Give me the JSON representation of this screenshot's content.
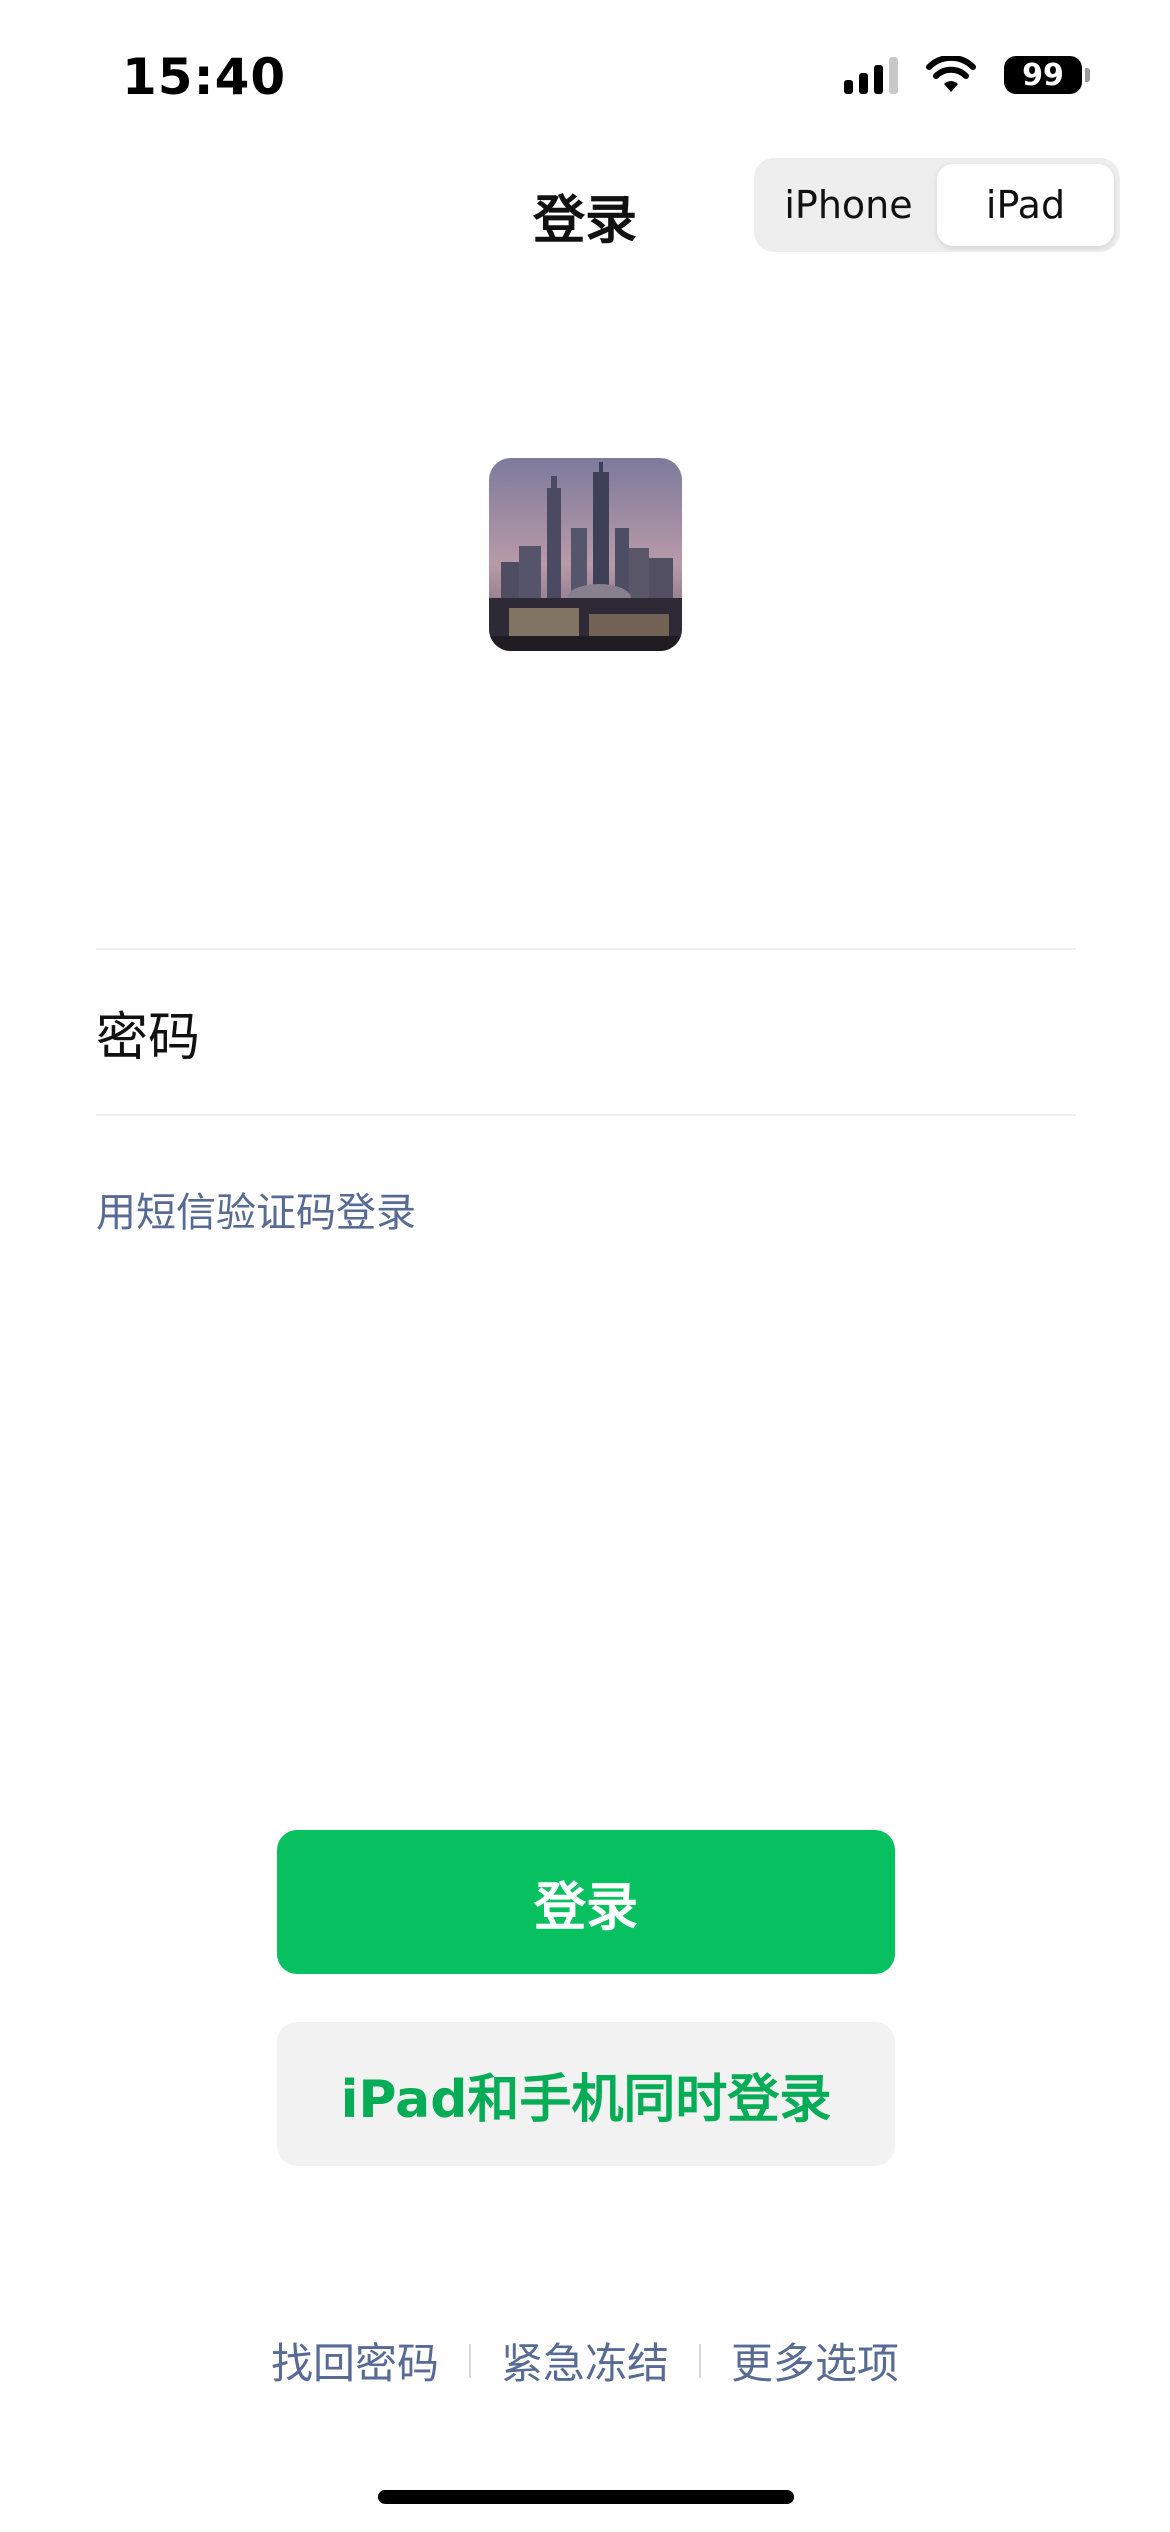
{
  "status_bar": {
    "time": "15:40",
    "battery": "99",
    "icons": [
      "signal-icon",
      "wifi-icon",
      "battery-icon"
    ]
  },
  "header": {
    "title": "登录",
    "device_toggle": {
      "options": [
        "iPhone",
        "iPad"
      ],
      "selected": "iPad"
    }
  },
  "account": {
    "avatar": "city-skyline-photo"
  },
  "form": {
    "password_label": "密码",
    "sms_login_link": "用短信验证码登录"
  },
  "buttons": {
    "login": "登录",
    "dual_login": "iPad和手机同时登录"
  },
  "footer": {
    "recover_password": "找回密码",
    "emergency_freeze": "紧急冻结",
    "more_options": "更多选项"
  },
  "colors": {
    "primary_green": "#07c160",
    "link_blue": "#576b95",
    "secondary_button_bg": "#f2f2f2"
  }
}
